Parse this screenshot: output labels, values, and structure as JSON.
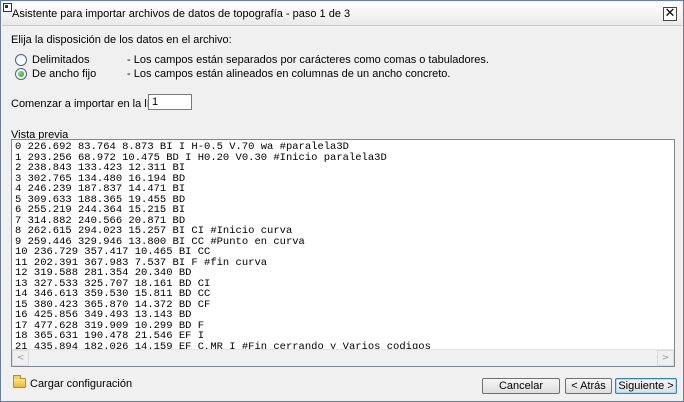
{
  "window": {
    "title": "Asistente para importar archivos de datos de topografía - paso 1 de 3",
    "close_glyph": "✕"
  },
  "layout_section": {
    "label": "Elija la disposición de los datos en el archivo:",
    "options": [
      {
        "label": "Delimitados",
        "description": "- Los campos están separados por carácteres como comas o tabuladores.",
        "selected": false
      },
      {
        "label": "De ancho fijo",
        "description": "- Los campos están alineados en columnas de un ancho concreto.",
        "selected": true
      }
    ]
  },
  "start_line": {
    "label": "Comenzar a importar en la línea:",
    "value": "1"
  },
  "preview": {
    "label": "Vista previa",
    "lines": [
      "0 226.692 83.764 8.873 BI I H-0.5 V.70 wa #paralela3D",
      "1 293.256 68.972 10.475 BD I H0.20 V0.30 #Inicio paralela3D",
      "2 238.843 133.423 12.311 BI",
      "3 302.765 134.480 16.194 BD",
      "4 246.239 187.837 14.471 BI",
      "5 309.633 188.365 19.455 BD",
      "6 255.219 244.364 15.215 BI",
      "7 314.882 240.566 20.871 BD",
      "8 262.615 294.023 15.257 BI CI #Inicio curva",
      "9 259.446 329.946 13.800 BI CC #Punto en curva",
      "10 236.729 357.417 10.465 BI CC",
      "11 202.391 367.983 7.537 BI F #fin curva",
      "12 319.588 281.354 20.340 BD",
      "13 327.533 325.707 18.161 BD CI",
      "14 346.613 359.530 15.811 BD CC",
      "15 380.423 365.870 14.372 BD CF",
      "16 425.856 349.493 13.143 BD",
      "17 477.628 319.909 10.299 BD F",
      "18 365.631 190.478 21.546 EF I",
      "21 435.894 182.026 14.159 EF C,MR I #Fin cerrando y Varios codigos"
    ],
    "scroll_left_glyph": "<",
    "scroll_right_glyph": ">"
  },
  "footer": {
    "load_config": "Cargar configuración",
    "cancel": "Cancelar",
    "back": "< Atrás",
    "next": "Siguiente >"
  },
  "icons": {
    "folder": "folder-icon",
    "app": "app-icon",
    "close": "close-icon"
  }
}
